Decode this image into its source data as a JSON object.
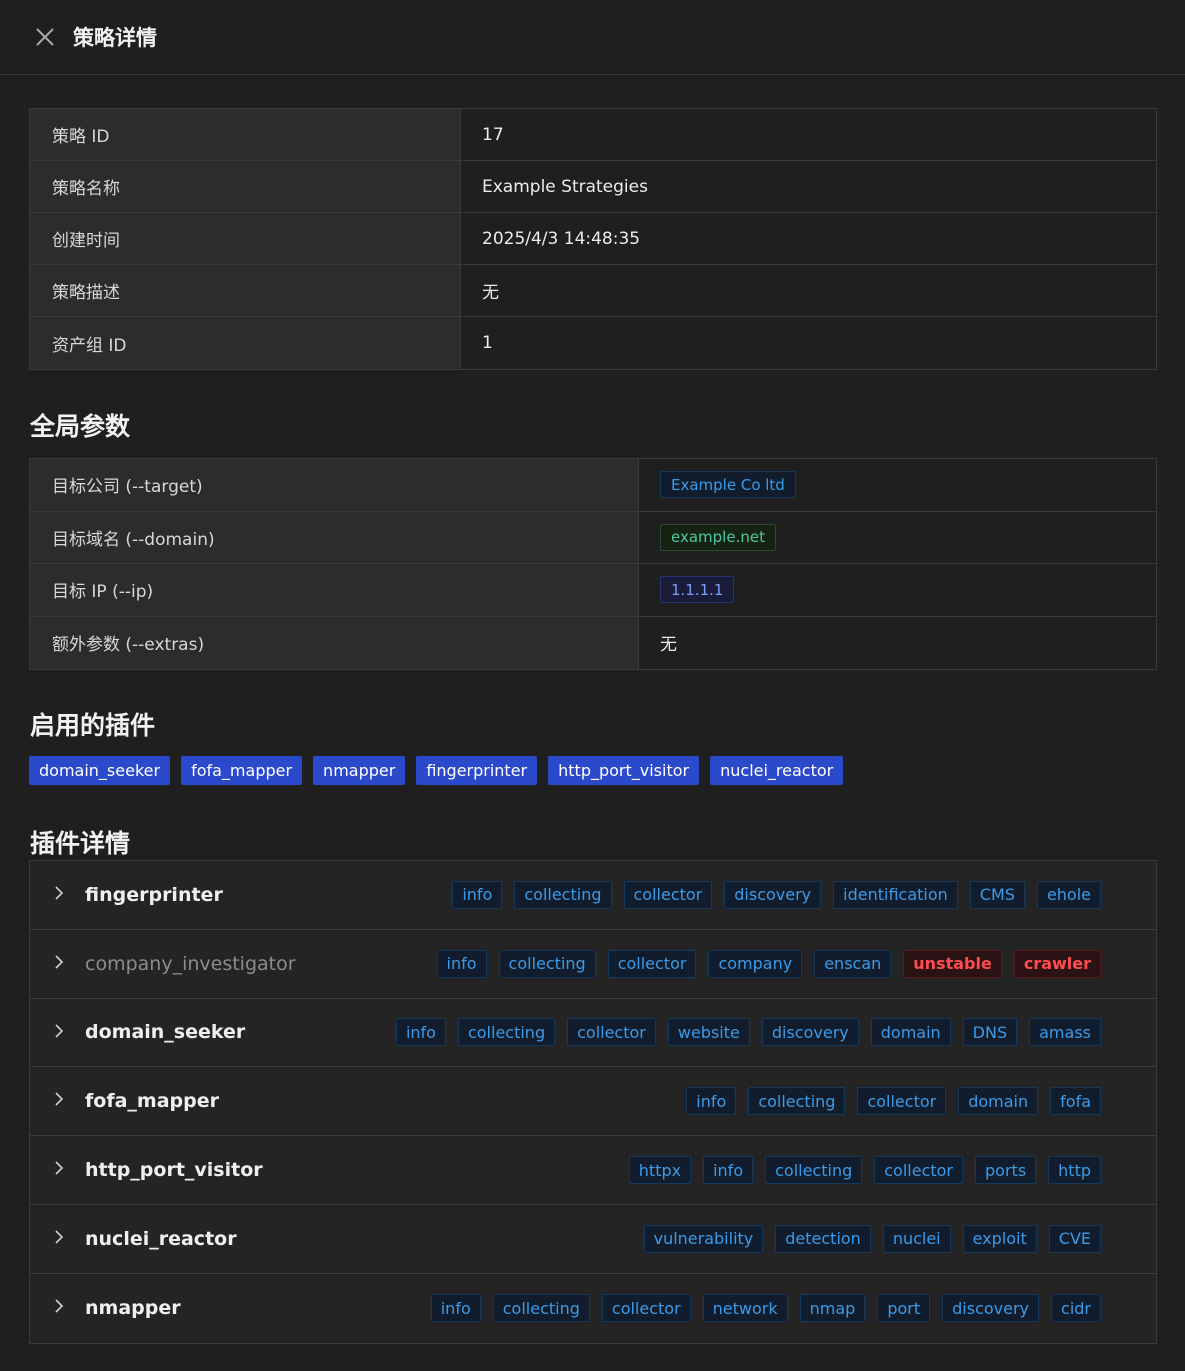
{
  "drawer": {
    "title": "策略详情"
  },
  "basic_info": [
    {
      "label": "策略 ID",
      "value": "17"
    },
    {
      "label": "策略名称",
      "value": "Example Strategies"
    },
    {
      "label": "创建时间",
      "value": "2025/4/3 14:48:35"
    },
    {
      "label": "策略描述",
      "value": "无"
    },
    {
      "label": "资产组 ID",
      "value": "1"
    }
  ],
  "global_params": {
    "title": "全局参数",
    "rows": [
      {
        "label": "目标公司 (--target)",
        "value": "Example Co ltd",
        "style": "blue"
      },
      {
        "label": "目标域名 (--domain)",
        "value": "example.net",
        "style": "green"
      },
      {
        "label": "目标 IP (--ip)",
        "value": "1.1.1.1",
        "style": "purple"
      },
      {
        "label": "额外参数 (--extras)",
        "value": "无",
        "style": "plain"
      }
    ]
  },
  "enabled_plugins": {
    "title": "启用的插件",
    "items": [
      "domain_seeker",
      "fofa_mapper",
      "nmapper",
      "fingerprinter",
      "http_port_visitor",
      "nuclei_reactor"
    ]
  },
  "plugin_details": {
    "title": "插件详情",
    "items": [
      {
        "name": "fingerprinter",
        "muted": false,
        "tags": [
          "info",
          "collecting",
          "collector",
          "discovery",
          "identification",
          "CMS",
          "ehole"
        ]
      },
      {
        "name": "company_investigator",
        "muted": true,
        "tags": [
          "info",
          "collecting",
          "collector",
          "company",
          "enscan",
          "unstable",
          "crawler"
        ],
        "red_tags": [
          "unstable",
          "crawler"
        ]
      },
      {
        "name": "domain_seeker",
        "muted": false,
        "tags": [
          "info",
          "collecting",
          "collector",
          "website",
          "discovery",
          "domain",
          "DNS",
          "amass"
        ]
      },
      {
        "name": "fofa_mapper",
        "muted": false,
        "tags": [
          "info",
          "collecting",
          "collector",
          "domain",
          "fofa"
        ]
      },
      {
        "name": "http_port_visitor",
        "muted": false,
        "tags": [
          "httpx",
          "info",
          "collecting",
          "collector",
          "ports",
          "http"
        ]
      },
      {
        "name": "nuclei_reactor",
        "muted": false,
        "tags": [
          "vulnerability",
          "detection",
          "nuclei",
          "exploit",
          "CVE"
        ]
      },
      {
        "name": "nmapper",
        "muted": false,
        "tags": [
          "info",
          "collecting",
          "collector",
          "network",
          "nmap",
          "port",
          "discovery",
          "cidr"
        ]
      }
    ]
  }
}
